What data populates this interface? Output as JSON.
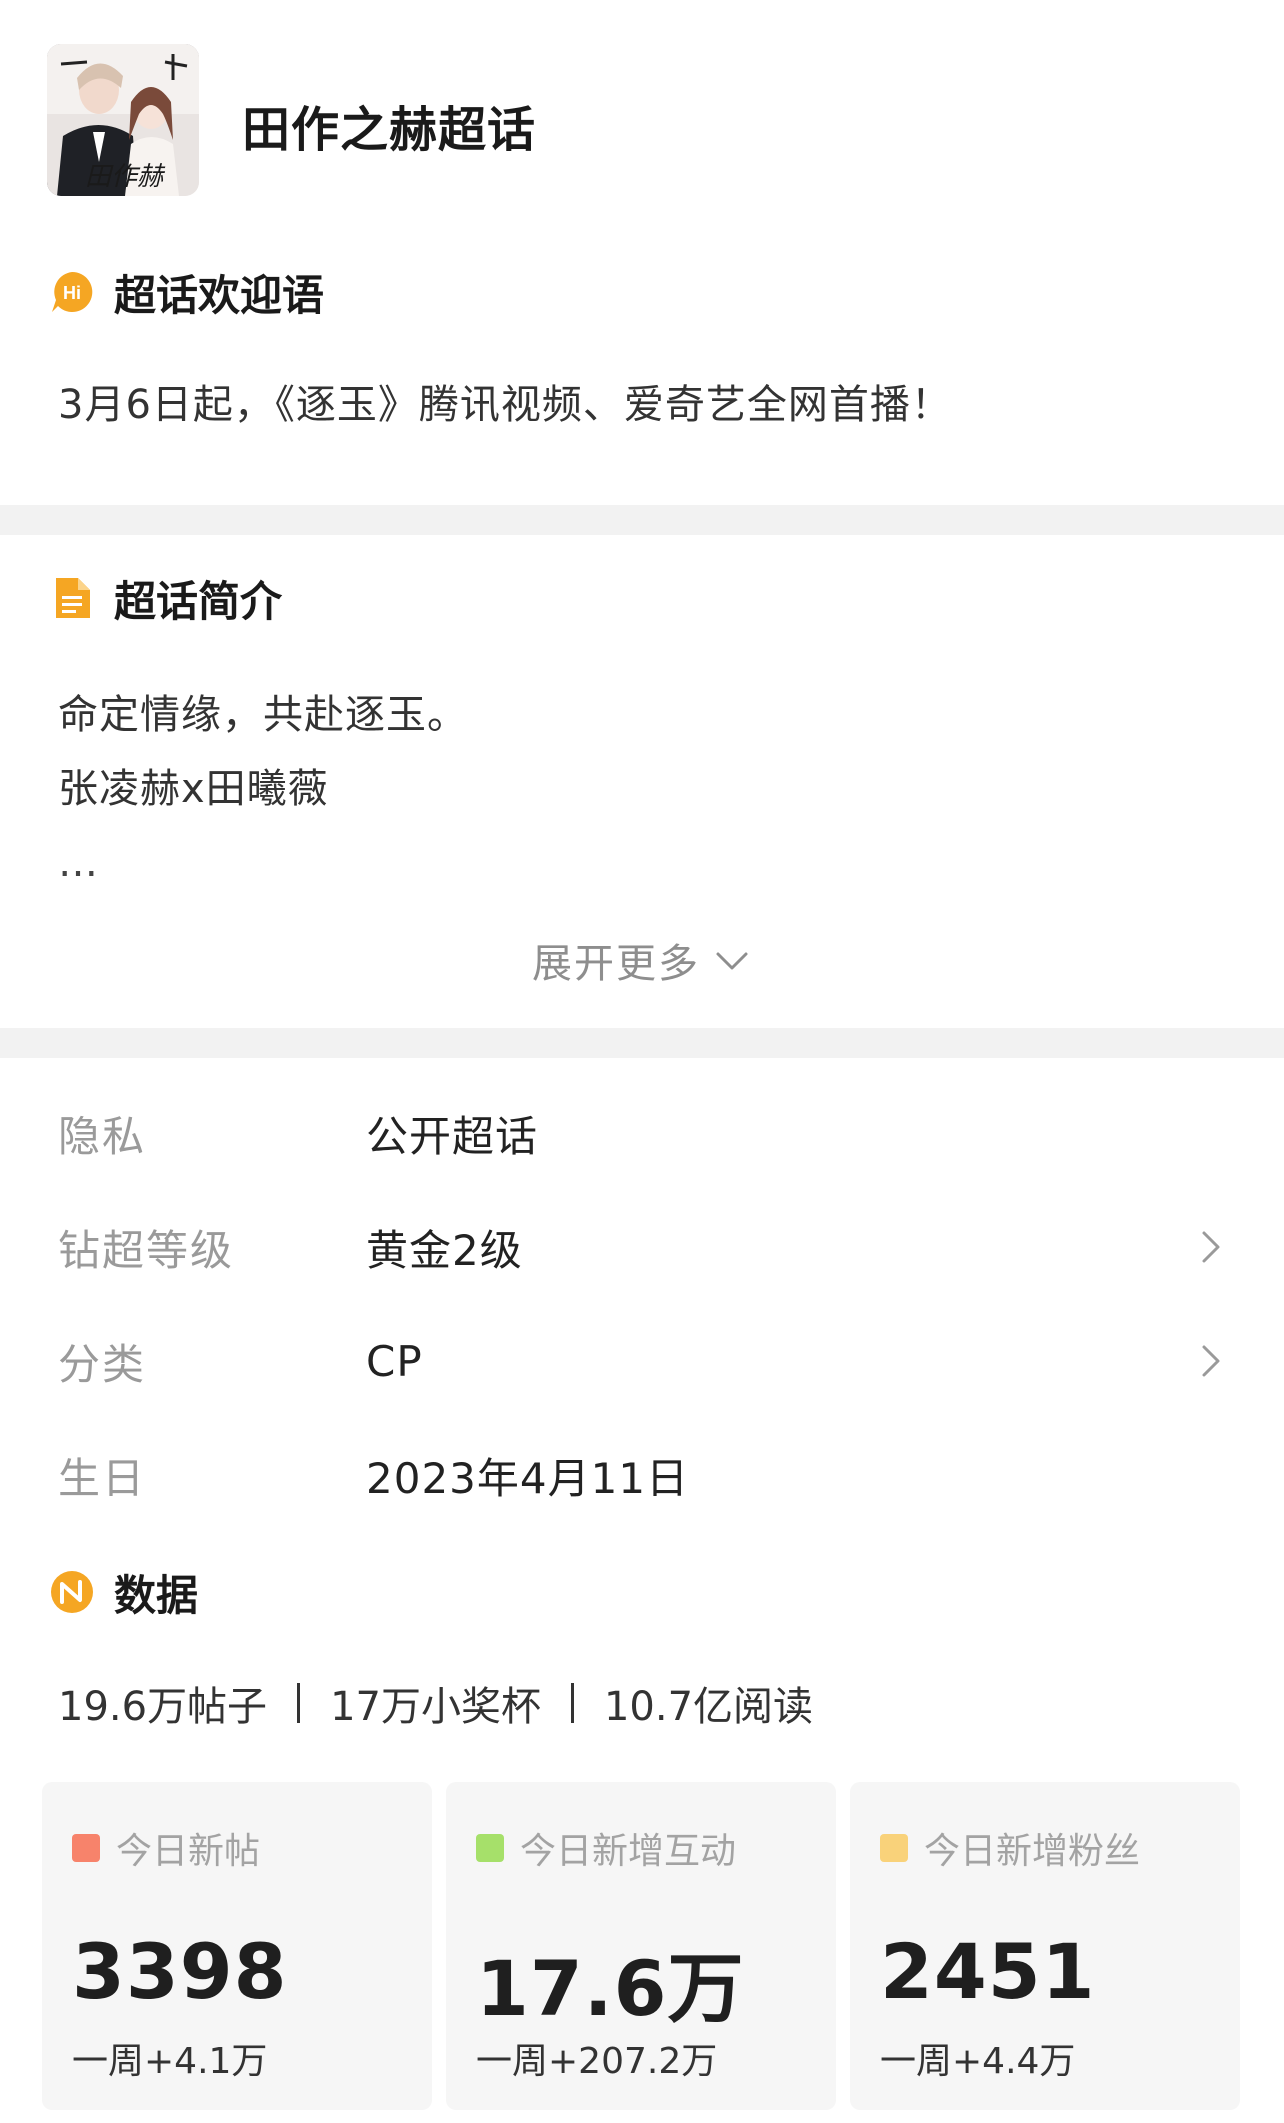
{
  "header": {
    "title": "田作之赫超话",
    "avatar_caption": "田作赫"
  },
  "welcome": {
    "heading": "超话欢迎语",
    "icon": "hi-icon",
    "icon_text": "Hi",
    "icon_color": "#F5A623",
    "text": "3月6日起，《逐玉》腾讯视频、爱奇艺全网首播！"
  },
  "intro": {
    "heading": "超话简介",
    "icon": "document-icon",
    "icon_color": "#F5A623",
    "lines": [
      "命定情缘，共赴逐玉。",
      "张凌赫x田曦薇"
    ],
    "ellipsis": "…",
    "expand_label": "展开更多"
  },
  "info": {
    "rows": [
      {
        "label": "隐私",
        "value": "公开超话",
        "has_arrow": false
      },
      {
        "label": "钻超等级",
        "value": "黄金2级",
        "has_arrow": true
      },
      {
        "label": "分类",
        "value": "CP",
        "has_arrow": true
      },
      {
        "label": "生日",
        "value": "2023年4月11日",
        "has_arrow": false
      }
    ]
  },
  "stats": {
    "heading": "数据",
    "icon": "data-icon",
    "icon_text": "N",
    "icon_color": "#F5A623",
    "items": [
      "19.6万帖子",
      "17万小奖杯",
      "10.7亿阅读"
    ]
  },
  "cards": [
    {
      "label": "今日新帖",
      "value": "3398",
      "week": "一周+4.1万",
      "color": "#F7836B"
    },
    {
      "label": "今日新增互动",
      "value": "17.6万",
      "week": "一周+207.2万",
      "color": "#A6E06A"
    },
    {
      "label": "今日新增粉丝",
      "value": "2451",
      "week": "一周+4.4万",
      "color": "#F9D27A"
    }
  ]
}
